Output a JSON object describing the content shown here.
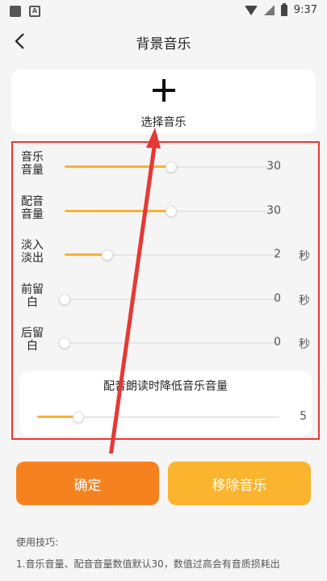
{
  "status_bar": {
    "time": "9:37",
    "icons": [
      "square-icon",
      "a-icon",
      "wifi-icon",
      "signal-icon",
      "battery-icon"
    ]
  },
  "header": {
    "title": "背景音乐",
    "back_icon": "chevron-left-icon"
  },
  "select_music": {
    "icon": "plus-icon",
    "label": "选择音乐"
  },
  "sliders": [
    {
      "label": "音乐音量",
      "value": "30",
      "unit": "",
      "fraction": 0.5
    },
    {
      "label": "配音音量",
      "value": "30",
      "unit": "",
      "fraction": 0.5
    },
    {
      "label": "淡入淡出",
      "value": "2",
      "unit": "秒",
      "fraction": 0.2
    },
    {
      "label": "前留白",
      "value": "0",
      "unit": "秒",
      "fraction": 0.0
    },
    {
      "label": "后留白",
      "value": "0",
      "unit": "秒",
      "fraction": 0.0
    }
  ],
  "duck": {
    "title": "配音朗读时降低音乐音量",
    "value": "5",
    "fraction": 0.17
  },
  "buttons": {
    "confirm": "确定",
    "remove": "移除音乐"
  },
  "tips": {
    "title": "使用技巧:",
    "line1": "1.音乐音量、配音音量数值默认30，数值过高会有音质损耗出"
  },
  "colors": {
    "accent": "#f9b233",
    "confirm": "#f5821f",
    "remove": "#fbb42d",
    "annotation": "#e53935"
  }
}
